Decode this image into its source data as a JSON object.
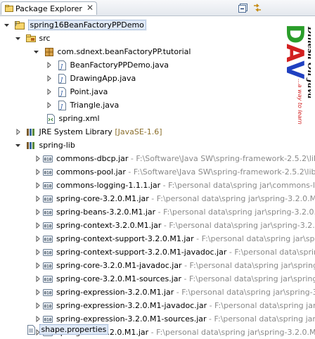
{
  "view": {
    "title": "Package Explorer",
    "close_glyph": "✕",
    "icons": [
      "package-explorer-icon",
      "close-icon",
      "collapse-all-icon",
      "link-with-editor-icon"
    ]
  },
  "tree": {
    "project": "spring16BeanFactoryPPDemo",
    "src": "src",
    "package": "com.sdnext.beanFactoryPP.tutorial",
    "java_files": [
      "BeanFactoryPPDemo.java",
      "DrawingApp.java",
      "Point.java",
      "Triangle.java"
    ],
    "spring_xml": "spring.xml",
    "jre": {
      "label": "JRE System Library",
      "version": "[JavaSE-1.6]"
    },
    "spring_lib": "spring-lib",
    "jars": [
      {
        "name": "commons-dbcp.jar",
        "loc": " - F:\\Software\\Java SW\\spring-framework-2.5.2\\lib"
      },
      {
        "name": "commons-pool.jar",
        "loc": " - F:\\Software\\Java SW\\spring-framework-2.5.2\\lib\\"
      },
      {
        "name": "commons-logging-1.1.1.jar",
        "loc": " - F:\\personal data\\spring jar\\commons-lo"
      },
      {
        "name": "spring-core-3.2.0.M1.jar",
        "loc": " - F:\\personal data\\spring jar\\spring-3.2.0.M1 -"
      },
      {
        "name": "spring-beans-3.2.0.M1.jar",
        "loc": " - F:\\personal data\\spring jar\\spring-3.2.0.M"
      },
      {
        "name": "spring-context-3.2.0.M1.jar",
        "loc": " - F:\\personal data\\spring jar\\spring-3.2.0.M"
      },
      {
        "name": "spring-context-support-3.2.0.M1.jar",
        "loc": " - F:\\personal data\\spring jar\\spring"
      },
      {
        "name": "spring-context-support-3.2.0.M1-javadoc.jar",
        "loc": " - F:\\personal data\\spring"
      },
      {
        "name": "spring-core-3.2.0.M1-javadoc.jar",
        "loc": " - F:\\personal data\\spring jar\\spring-"
      },
      {
        "name": "spring-core-3.2.0.M1-sources.jar",
        "loc": " - F:\\personal data\\spring jar\\spring-3"
      },
      {
        "name": "spring-expression-3.2.0.M1.jar",
        "loc": " - F:\\personal data\\spring jar\\spring-3.2"
      },
      {
        "name": "spring-expression-3.2.0.M1-javadoc.jar",
        "loc": " - F:\\personal data\\spring jar\\sp"
      },
      {
        "name": "spring-expression-3.2.0.M1-sources.jar",
        "loc": " - F:\\personal data\\spring jar\\sp"
      },
      {
        "name": "spring-asm-3.2.0.M1.jar",
        "loc": " - F:\\personal data\\spring jar\\spring-3.2.0.M1 -"
      }
    ],
    "properties_file": "shape.properties",
    "jar_icon_text": "010"
  },
  "watermark": {
    "logo_text": "DAV",
    "tagline": "Dinesh On Java",
    "subline": "...a way to learn",
    "colors": {
      "d": "#2a9d2a",
      "a": "#d22020",
      "v": "#2040c0",
      "tagline": "#111111",
      "subline": "#d22020"
    }
  }
}
